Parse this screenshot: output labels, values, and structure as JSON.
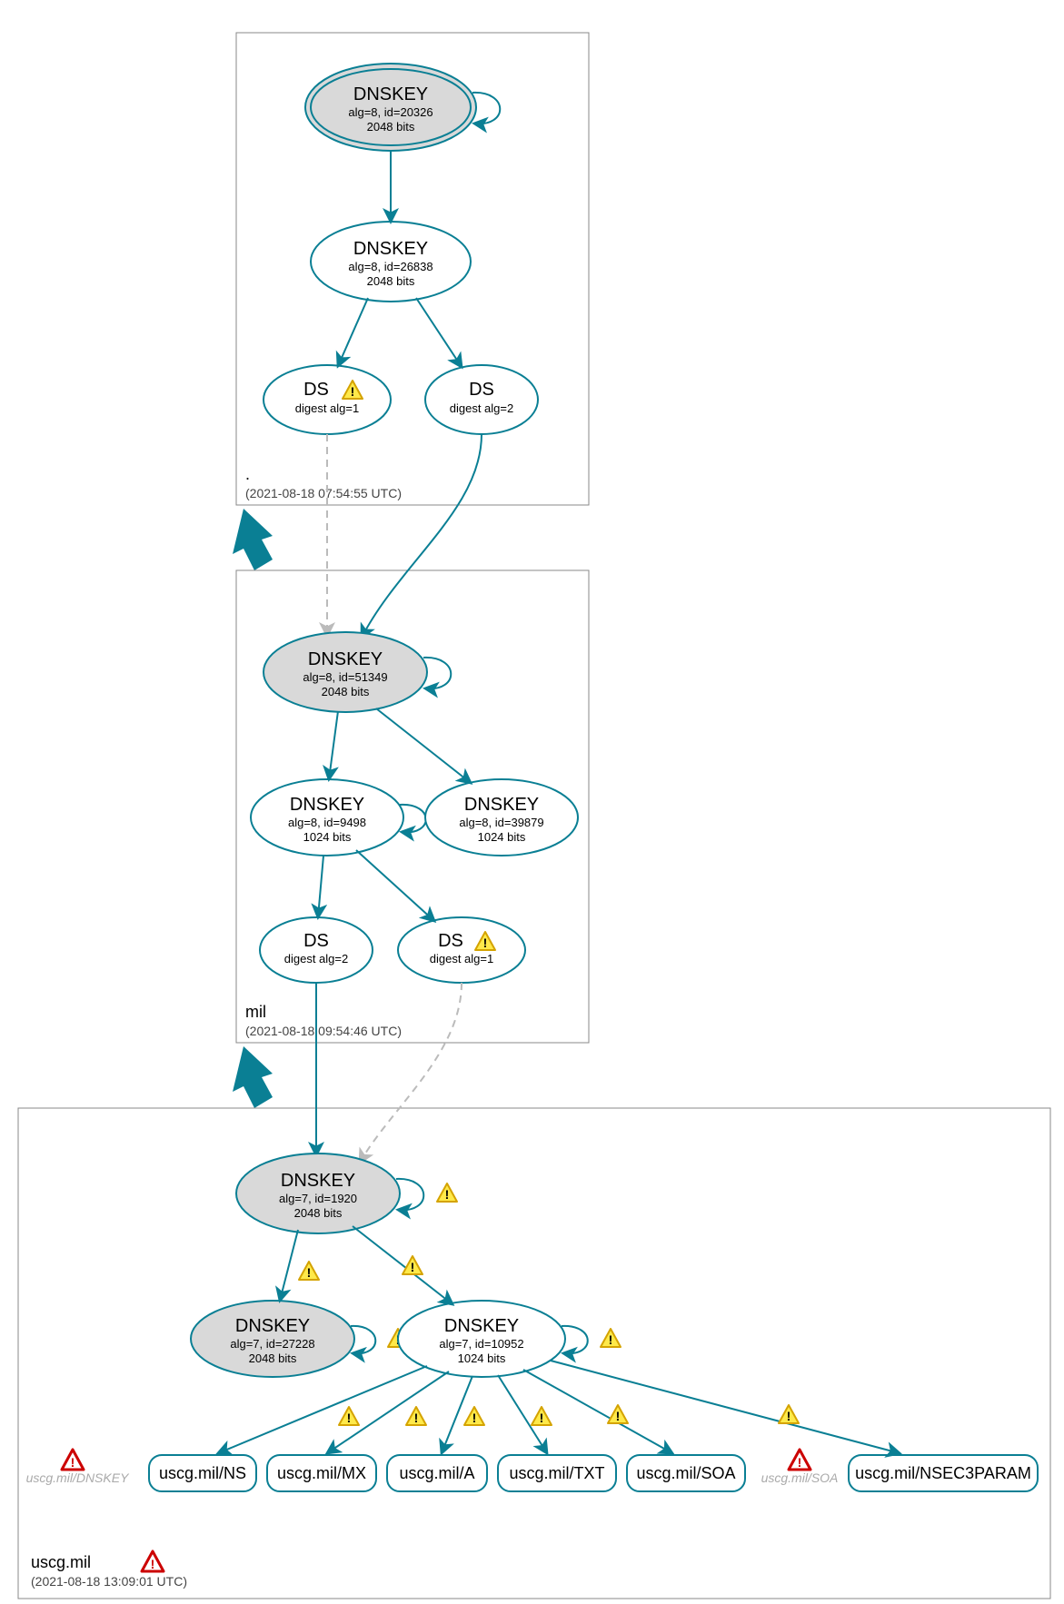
{
  "colors": {
    "teal": "#0a7f94",
    "grey_fill": "#d9d9d9",
    "warn_fill": "#ffe94a",
    "warn_stroke": "#d4a300",
    "err_stroke": "#cc0000"
  },
  "zones": {
    "root": {
      "label": ".",
      "timestamp": "(2021-08-18 07:54:55 UTC)"
    },
    "mil": {
      "label": "mil",
      "timestamp": "(2021-08-18 09:54:46 UTC)"
    },
    "uscg": {
      "label": "uscg.mil",
      "timestamp": "(2021-08-18 13:09:01 UTC)"
    }
  },
  "nodes": {
    "root_ksk": {
      "title": "DNSKEY",
      "sub1": "alg=8, id=20326",
      "sub2": "2048 bits"
    },
    "root_zsk": {
      "title": "DNSKEY",
      "sub1": "alg=8, id=26838",
      "sub2": "2048 bits"
    },
    "root_ds1": {
      "title": "DS",
      "sub1": "digest alg=1"
    },
    "root_ds2": {
      "title": "DS",
      "sub1": "digest alg=2"
    },
    "mil_ksk": {
      "title": "DNSKEY",
      "sub1": "alg=8, id=51349",
      "sub2": "2048 bits"
    },
    "mil_zsk": {
      "title": "DNSKEY",
      "sub1": "alg=8, id=9498",
      "sub2": "1024 bits"
    },
    "mil_zsk2": {
      "title": "DNSKEY",
      "sub1": "alg=8, id=39879",
      "sub2": "1024 bits"
    },
    "mil_ds2": {
      "title": "DS",
      "sub1": "digest alg=2"
    },
    "mil_ds1": {
      "title": "DS",
      "sub1": "digest alg=1"
    },
    "uscg_ksk": {
      "title": "DNSKEY",
      "sub1": "alg=7, id=1920",
      "sub2": "2048 bits"
    },
    "uscg_zsk2": {
      "title": "DNSKEY",
      "sub1": "alg=7, id=27228",
      "sub2": "2048 bits"
    },
    "uscg_zsk": {
      "title": "DNSKEY",
      "sub1": "alg=7, id=10952",
      "sub2": "1024 bits"
    }
  },
  "rrsets": {
    "ns": "uscg.mil/NS",
    "mx": "uscg.mil/MX",
    "a": "uscg.mil/A",
    "txt": "uscg.mil/TXT",
    "soa": "uscg.mil/SOA",
    "nsec": "uscg.mil/NSEC3PARAM"
  },
  "ghosts": {
    "dnskey": "uscg.mil/DNSKEY",
    "soa": "uscg.mil/SOA"
  }
}
